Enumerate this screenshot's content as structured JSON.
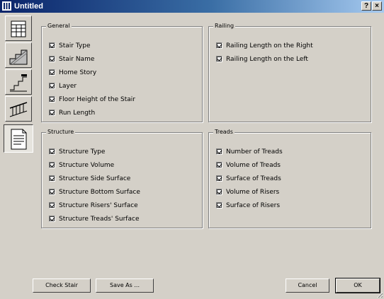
{
  "window": {
    "title": "Untitled",
    "help_label": "?",
    "close_label": "×"
  },
  "tabs": [
    {
      "name": "list-icon"
    },
    {
      "name": "stair-icon"
    },
    {
      "name": "stair-side-icon"
    },
    {
      "name": "railing-icon"
    },
    {
      "name": "document-icon",
      "selected": true
    }
  ],
  "groups": {
    "general": {
      "title": "General",
      "items": [
        "Stair Type",
        "Stair Name",
        "Home Story",
        "Layer",
        "Floor Height of the Stair",
        "Run Length"
      ]
    },
    "railing": {
      "title": "Railing",
      "items": [
        "Railing Length on the Right",
        "Railing Length on the Left"
      ]
    },
    "structure": {
      "title": "Structure",
      "items": [
        "Structure Type",
        "Structure Volume",
        "Structure Side Surface",
        "Structure Bottom Surface",
        "Structure Risers' Surface",
        "Structure Treads' Surface"
      ]
    },
    "treads": {
      "title": "Treads",
      "items": [
        "Number of Treads",
        "Volume of Treads",
        "Surface of Treads",
        "Volume of Risers",
        "Surface of Risers"
      ]
    }
  },
  "buttons": {
    "check_stair": "Check Stair",
    "save_as": "Save As ...",
    "cancel": "Cancel",
    "ok": "OK"
  }
}
